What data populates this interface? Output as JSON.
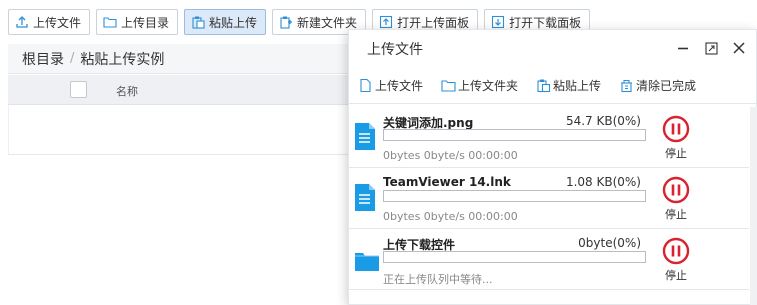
{
  "toolbar": {
    "buttons": [
      {
        "label": "上传文件",
        "icon": "upload-icon"
      },
      {
        "label": "上传目录",
        "icon": "folder-icon"
      },
      {
        "label": "粘贴上传",
        "icon": "paste-icon",
        "active": true
      },
      {
        "label": "新建文件夹",
        "icon": "new-folder-icon"
      },
      {
        "label": "打开上传面板",
        "icon": "upload-panel-icon"
      },
      {
        "label": "打开下载面板",
        "icon": "download-panel-icon"
      }
    ]
  },
  "breadcrumb": {
    "root": "根目录",
    "separator": "/",
    "current": "粘贴上传实例"
  },
  "table": {
    "column_name": "名称"
  },
  "panel": {
    "title": "上传文件",
    "tools": [
      {
        "label": "上传文件",
        "icon": "file-icon"
      },
      {
        "label": "上传文件夹",
        "icon": "folder-icon"
      },
      {
        "label": "粘贴上传",
        "icon": "paste-icon"
      },
      {
        "label": "清除已完成",
        "icon": "clear-icon"
      }
    ],
    "items": [
      {
        "name": "关键词添加.png",
        "size": "54.7 KB(0%)",
        "progress": 0,
        "status": "0bytes 0byte/s 00:00:00",
        "stop_label": "停止",
        "icon": "file-icon"
      },
      {
        "name": "TeamViewer 14.lnk",
        "size": "1.08 KB(0%)",
        "progress": 0,
        "status": "0bytes 0byte/s 00:00:00",
        "stop_label": "停止",
        "icon": "file-icon"
      },
      {
        "name": "上传下载控件",
        "size": "0byte(0%)",
        "progress": 0,
        "status": "正在上传队列中等待...",
        "stop_label": "停止",
        "icon": "folder-icon"
      }
    ]
  },
  "colors": {
    "accent": "#1a9be6",
    "stop": "#d9232e",
    "active_button_bg": "#dbe9f8"
  }
}
